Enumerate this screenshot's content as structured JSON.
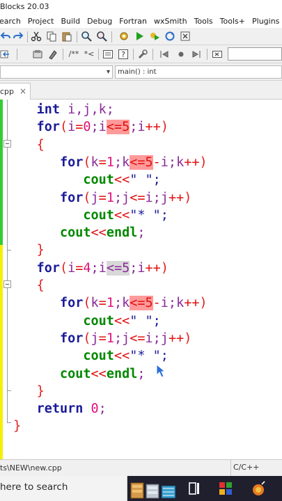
{
  "window": {
    "title": "Blocks 20.03"
  },
  "menu": [
    "earch",
    "Project",
    "Build",
    "Debug",
    "Fortran",
    "wxSmith",
    "Tools",
    "Tools+",
    "Plugins"
  ],
  "toolbar2": {
    "comment_label": "/**",
    "uncomment_label": "*<"
  },
  "scope": {
    "function": "main() : int"
  },
  "tab": {
    "label": "cpp",
    "close": "×"
  },
  "code_lines": [
    {
      "indent": "    ",
      "tokens": [
        [
          "kw",
          "int"
        ],
        [
          "id",
          " i,j,k;"
        ]
      ]
    },
    {
      "indent": "    ",
      "tokens": [
        [
          "kw",
          "for"
        ],
        [
          "br",
          "("
        ],
        [
          "id",
          "i"
        ],
        [
          "op",
          "="
        ],
        [
          "num",
          "0"
        ],
        [
          "id",
          ";i"
        ],
        [
          "hl",
          "<=5"
        ],
        [
          "id",
          ";i"
        ],
        [
          "op",
          "++"
        ],
        [
          "br",
          ")"
        ]
      ]
    },
    {
      "indent": "    ",
      "tokens": [
        [
          "br",
          "{"
        ]
      ]
    },
    {
      "indent": "       ",
      "tokens": [
        [
          "kw",
          "for"
        ],
        [
          "br",
          "("
        ],
        [
          "id",
          "k"
        ],
        [
          "op",
          "="
        ],
        [
          "num",
          "1"
        ],
        [
          "id",
          ";k"
        ],
        [
          "hl",
          "<=5"
        ],
        [
          "op",
          "-"
        ],
        [
          "id",
          "i;k"
        ],
        [
          "op",
          "++"
        ],
        [
          "br",
          ")"
        ]
      ]
    },
    {
      "indent": "          ",
      "tokens": [
        [
          "grn",
          "cout"
        ],
        [
          "op",
          "<<"
        ],
        [
          "str",
          "\" \";"
        ]
      ]
    },
    {
      "indent": "       ",
      "tokens": [
        [
          "kw",
          "for"
        ],
        [
          "br",
          "("
        ],
        [
          "id",
          "j"
        ],
        [
          "op",
          "="
        ],
        [
          "num",
          "1"
        ],
        [
          "id",
          ";j"
        ],
        [
          "op",
          "<="
        ],
        [
          "id",
          "i;j"
        ],
        [
          "op",
          "++"
        ],
        [
          "br",
          ")"
        ]
      ]
    },
    {
      "indent": "          ",
      "tokens": [
        [
          "grn",
          "cout"
        ],
        [
          "op",
          "<<"
        ],
        [
          "str",
          "\"* \";"
        ]
      ]
    },
    {
      "indent": "       ",
      "tokens": [
        [
          "grn",
          "cout"
        ],
        [
          "op",
          "<<"
        ],
        [
          "grn",
          "endl"
        ],
        [
          "id",
          ";"
        ]
      ]
    },
    {
      "indent": "    ",
      "tokens": [
        [
          "br",
          "}"
        ]
      ]
    },
    {
      "indent": "    ",
      "tokens": [
        [
          "kw",
          "for"
        ],
        [
          "br",
          "("
        ],
        [
          "id",
          "i"
        ],
        [
          "op",
          "="
        ],
        [
          "num",
          "4"
        ],
        [
          "id",
          ";i"
        ],
        [
          "hlg",
          "<=5"
        ],
        [
          "id",
          ";i"
        ],
        [
          "op",
          "++"
        ],
        [
          "br",
          ")"
        ]
      ]
    },
    {
      "indent": "    ",
      "tokens": [
        [
          "br",
          "{"
        ]
      ]
    },
    {
      "indent": "       ",
      "tokens": [
        [
          "kw",
          "for"
        ],
        [
          "br",
          "("
        ],
        [
          "id",
          "k"
        ],
        [
          "op",
          "="
        ],
        [
          "num",
          "1"
        ],
        [
          "id",
          ";k"
        ],
        [
          "hl",
          "<=5"
        ],
        [
          "op",
          "-"
        ],
        [
          "id",
          "i;k"
        ],
        [
          "op",
          "++"
        ],
        [
          "br",
          ")"
        ]
      ]
    },
    {
      "indent": "          ",
      "tokens": [
        [
          "grn",
          "cout"
        ],
        [
          "op",
          "<<"
        ],
        [
          "str",
          "\" \";"
        ]
      ]
    },
    {
      "indent": "       ",
      "tokens": [
        [
          "kw",
          "for"
        ],
        [
          "br",
          "("
        ],
        [
          "id",
          "j"
        ],
        [
          "op",
          "="
        ],
        [
          "num",
          "1"
        ],
        [
          "id",
          ";j"
        ],
        [
          "op",
          "<="
        ],
        [
          "id",
          "i;j"
        ],
        [
          "op",
          "++"
        ],
        [
          "br",
          ")"
        ]
      ]
    },
    {
      "indent": "          ",
      "tokens": [
        [
          "grn",
          "cout"
        ],
        [
          "op",
          "<<"
        ],
        [
          "str",
          "\"* \";"
        ]
      ]
    },
    {
      "indent": "       ",
      "tokens": [
        [
          "grn",
          "cout"
        ],
        [
          "op",
          "<<"
        ],
        [
          "grn",
          "endl"
        ],
        [
          "id",
          ";"
        ]
      ]
    },
    {
      "indent": "    ",
      "tokens": [
        [
          "br",
          "}"
        ]
      ]
    },
    {
      "indent": "    ",
      "tokens": [
        [
          "kw",
          "return"
        ],
        [
          "id",
          " "
        ],
        [
          "num",
          "0"
        ],
        [
          "id",
          ";"
        ]
      ]
    },
    {
      "indent": " ",
      "tokens": [
        [
          "br",
          "}"
        ]
      ]
    }
  ],
  "status": {
    "path": "ts\\NEW\\new.cpp",
    "language": "C/C++"
  },
  "taskbar": {
    "search_text": " here to search"
  },
  "colors": {
    "gutter_modified": "#f5f000",
    "gutter_saved": "#33cc33",
    "highlight": "#ff9a9a",
    "taskbar": "#1f1f2e"
  }
}
